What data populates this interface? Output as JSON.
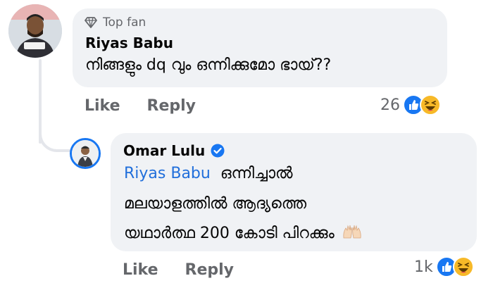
{
  "comment": {
    "badge_label": "Top fan",
    "author": "Riyas Babu",
    "text": "നിങ്ങളും dq വും ഒന്നിക്കുമോ ഭായ്??",
    "actions": {
      "like": "Like",
      "reply": "Reply"
    },
    "reaction_count": "26",
    "reaction_icons": [
      "like-icon",
      "haha-icon"
    ]
  },
  "reply": {
    "author": "Omar Lulu",
    "verified": true,
    "mention": "Riyas Babu",
    "text_line_1": "ഒന്നിച്ചാൽ",
    "text_line_2": "മലയാളത്തിൽ ആദ്യത്തെ",
    "text_line_3": "യഥാർത്ഥ 200 കോടി പിറക്കും",
    "emoji": "raising-hands-icon",
    "actions": {
      "like": "Like",
      "reply": "Reply"
    },
    "reaction_count": "1k",
    "reaction_icons": [
      "like-icon",
      "haha-icon"
    ]
  },
  "colors": {
    "bubble": "#f0f2f5",
    "mention": "#216fdb",
    "secondary_text": "#65676b",
    "verified_blue": "#1877f2",
    "haha_yellow": "#f7b928"
  }
}
